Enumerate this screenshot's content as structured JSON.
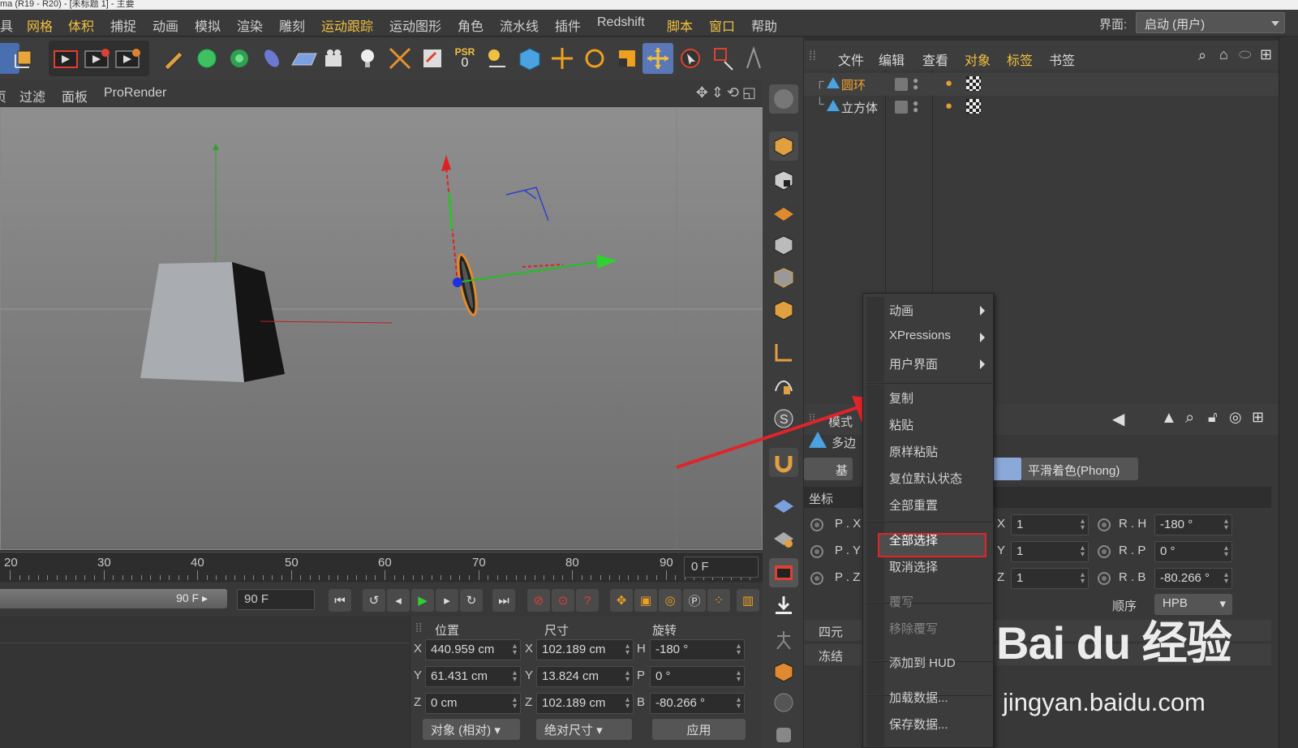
{
  "window_strip": "ma (R19 - R20) - [未标题 1] - 主要",
  "menu": {
    "items": [
      "具",
      "网格",
      "体积",
      "捕捉",
      "动画",
      "模拟",
      "渲染",
      "雕刻",
      "运动跟踪",
      "运动图形",
      "角色",
      "流水线",
      "插件",
      "Redshift",
      "脚本",
      "窗口",
      "帮助"
    ],
    "highlighted": [
      "网格",
      "体积",
      "运动跟踪",
      "脚本",
      "窗口"
    ],
    "layout_label": "界面:",
    "layout_value": "启动 (用户)"
  },
  "toolbar": {
    "psr_label": "PSR",
    "psr_value": "0"
  },
  "viewport_menu": {
    "items": [
      "页",
      "过滤",
      "面板",
      "ProRender"
    ]
  },
  "timeline": {
    "ticks": [
      "20",
      "30",
      "40",
      "50",
      "60",
      "70",
      "80",
      "90"
    ],
    "current_frame": "0 F",
    "range_end_display": "90 F",
    "end_field": "90 F"
  },
  "coordinates": {
    "headers": [
      "位置",
      "尺寸",
      "旋转"
    ],
    "rows": [
      {
        "axis": "X",
        "pos": "440.959 cm",
        "size_axis": "X",
        "size": "102.189 cm",
        "rot_axis": "H",
        "rot": "-180 °"
      },
      {
        "axis": "Y",
        "pos": "61.431 cm",
        "size_axis": "Y",
        "size": "13.824 cm",
        "rot_axis": "P",
        "rot": "0 °"
      },
      {
        "axis": "Z",
        "pos": "0 cm",
        "size_axis": "Z",
        "size": "102.189 cm",
        "rot_axis": "B",
        "rot": "-80.266 °"
      }
    ],
    "mode_dropdown": "对象 (相对)",
    "size_dropdown": "绝对尺寸",
    "apply_button": "应用"
  },
  "object_manager": {
    "menu": [
      "文件",
      "编辑",
      "查看",
      "对象",
      "标签",
      "书签"
    ],
    "objects": [
      {
        "name": "圆环",
        "color": "#f0a030"
      },
      {
        "name": "立方体",
        "color": "#d8d8d8"
      }
    ]
  },
  "attribute_manager": {
    "mode_label": "模式",
    "object_label": "多边",
    "tab_basic": "基",
    "tab_phong": "平滑着色(Phong)",
    "section_coords": "坐标",
    "p_labels": [
      "P . X",
      "P . Y",
      "P . Z"
    ],
    "scale": [
      {
        "axis": "X",
        "value": "1"
      },
      {
        "axis": "Y",
        "value": "1"
      },
      {
        "axis": "Z",
        "value": "1"
      }
    ],
    "rotation": [
      {
        "axis": "R . H",
        "value": "-180 °"
      },
      {
        "axis": "R . P",
        "value": "0 °"
      },
      {
        "axis": "R . B",
        "value": "-80.266 °"
      }
    ],
    "order_label": "顺序",
    "order_value": "HPB",
    "section_quat": "四元",
    "section_freeze": "冻结"
  },
  "context_menu": {
    "items": [
      {
        "label": "动画",
        "submenu": true,
        "disabled": false
      },
      {
        "label": "XPressions",
        "submenu": true,
        "disabled": false
      },
      {
        "label": "用户界面",
        "submenu": true,
        "disabled": false
      },
      {
        "label": "复制",
        "submenu": false,
        "disabled": false
      },
      {
        "label": "粘贴",
        "submenu": false,
        "disabled": false
      },
      {
        "label": "原样粘贴",
        "submenu": false,
        "disabled": false
      },
      {
        "label": "复位默认状态",
        "submenu": false,
        "disabled": false
      },
      {
        "label": "全部重置",
        "submenu": false,
        "disabled": false
      },
      {
        "label": "全部选择",
        "submenu": false,
        "disabled": false
      },
      {
        "label": "取消选择",
        "submenu": false,
        "disabled": false
      },
      {
        "label": "覆写",
        "submenu": false,
        "disabled": true
      },
      {
        "label": "移除覆写",
        "submenu": false,
        "disabled": true
      },
      {
        "label": "添加到 HUD",
        "submenu": false,
        "disabled": false
      },
      {
        "label": "加载数据...",
        "submenu": false,
        "disabled": false
      },
      {
        "label": "保存数据...",
        "submenu": false,
        "disabled": false
      }
    ],
    "highlighted_item": "全部选择",
    "highlight_color": "#e0242a"
  },
  "watermark": {
    "logo_text": "Bai du 经验",
    "url": "jingyan.baidu.com"
  },
  "colors": {
    "accent_yellow": "#f0c040",
    "annotation_red": "#e0242a",
    "axis_x": "#e03030",
    "axis_y": "#30c030",
    "axis_z": "#3050e0"
  }
}
